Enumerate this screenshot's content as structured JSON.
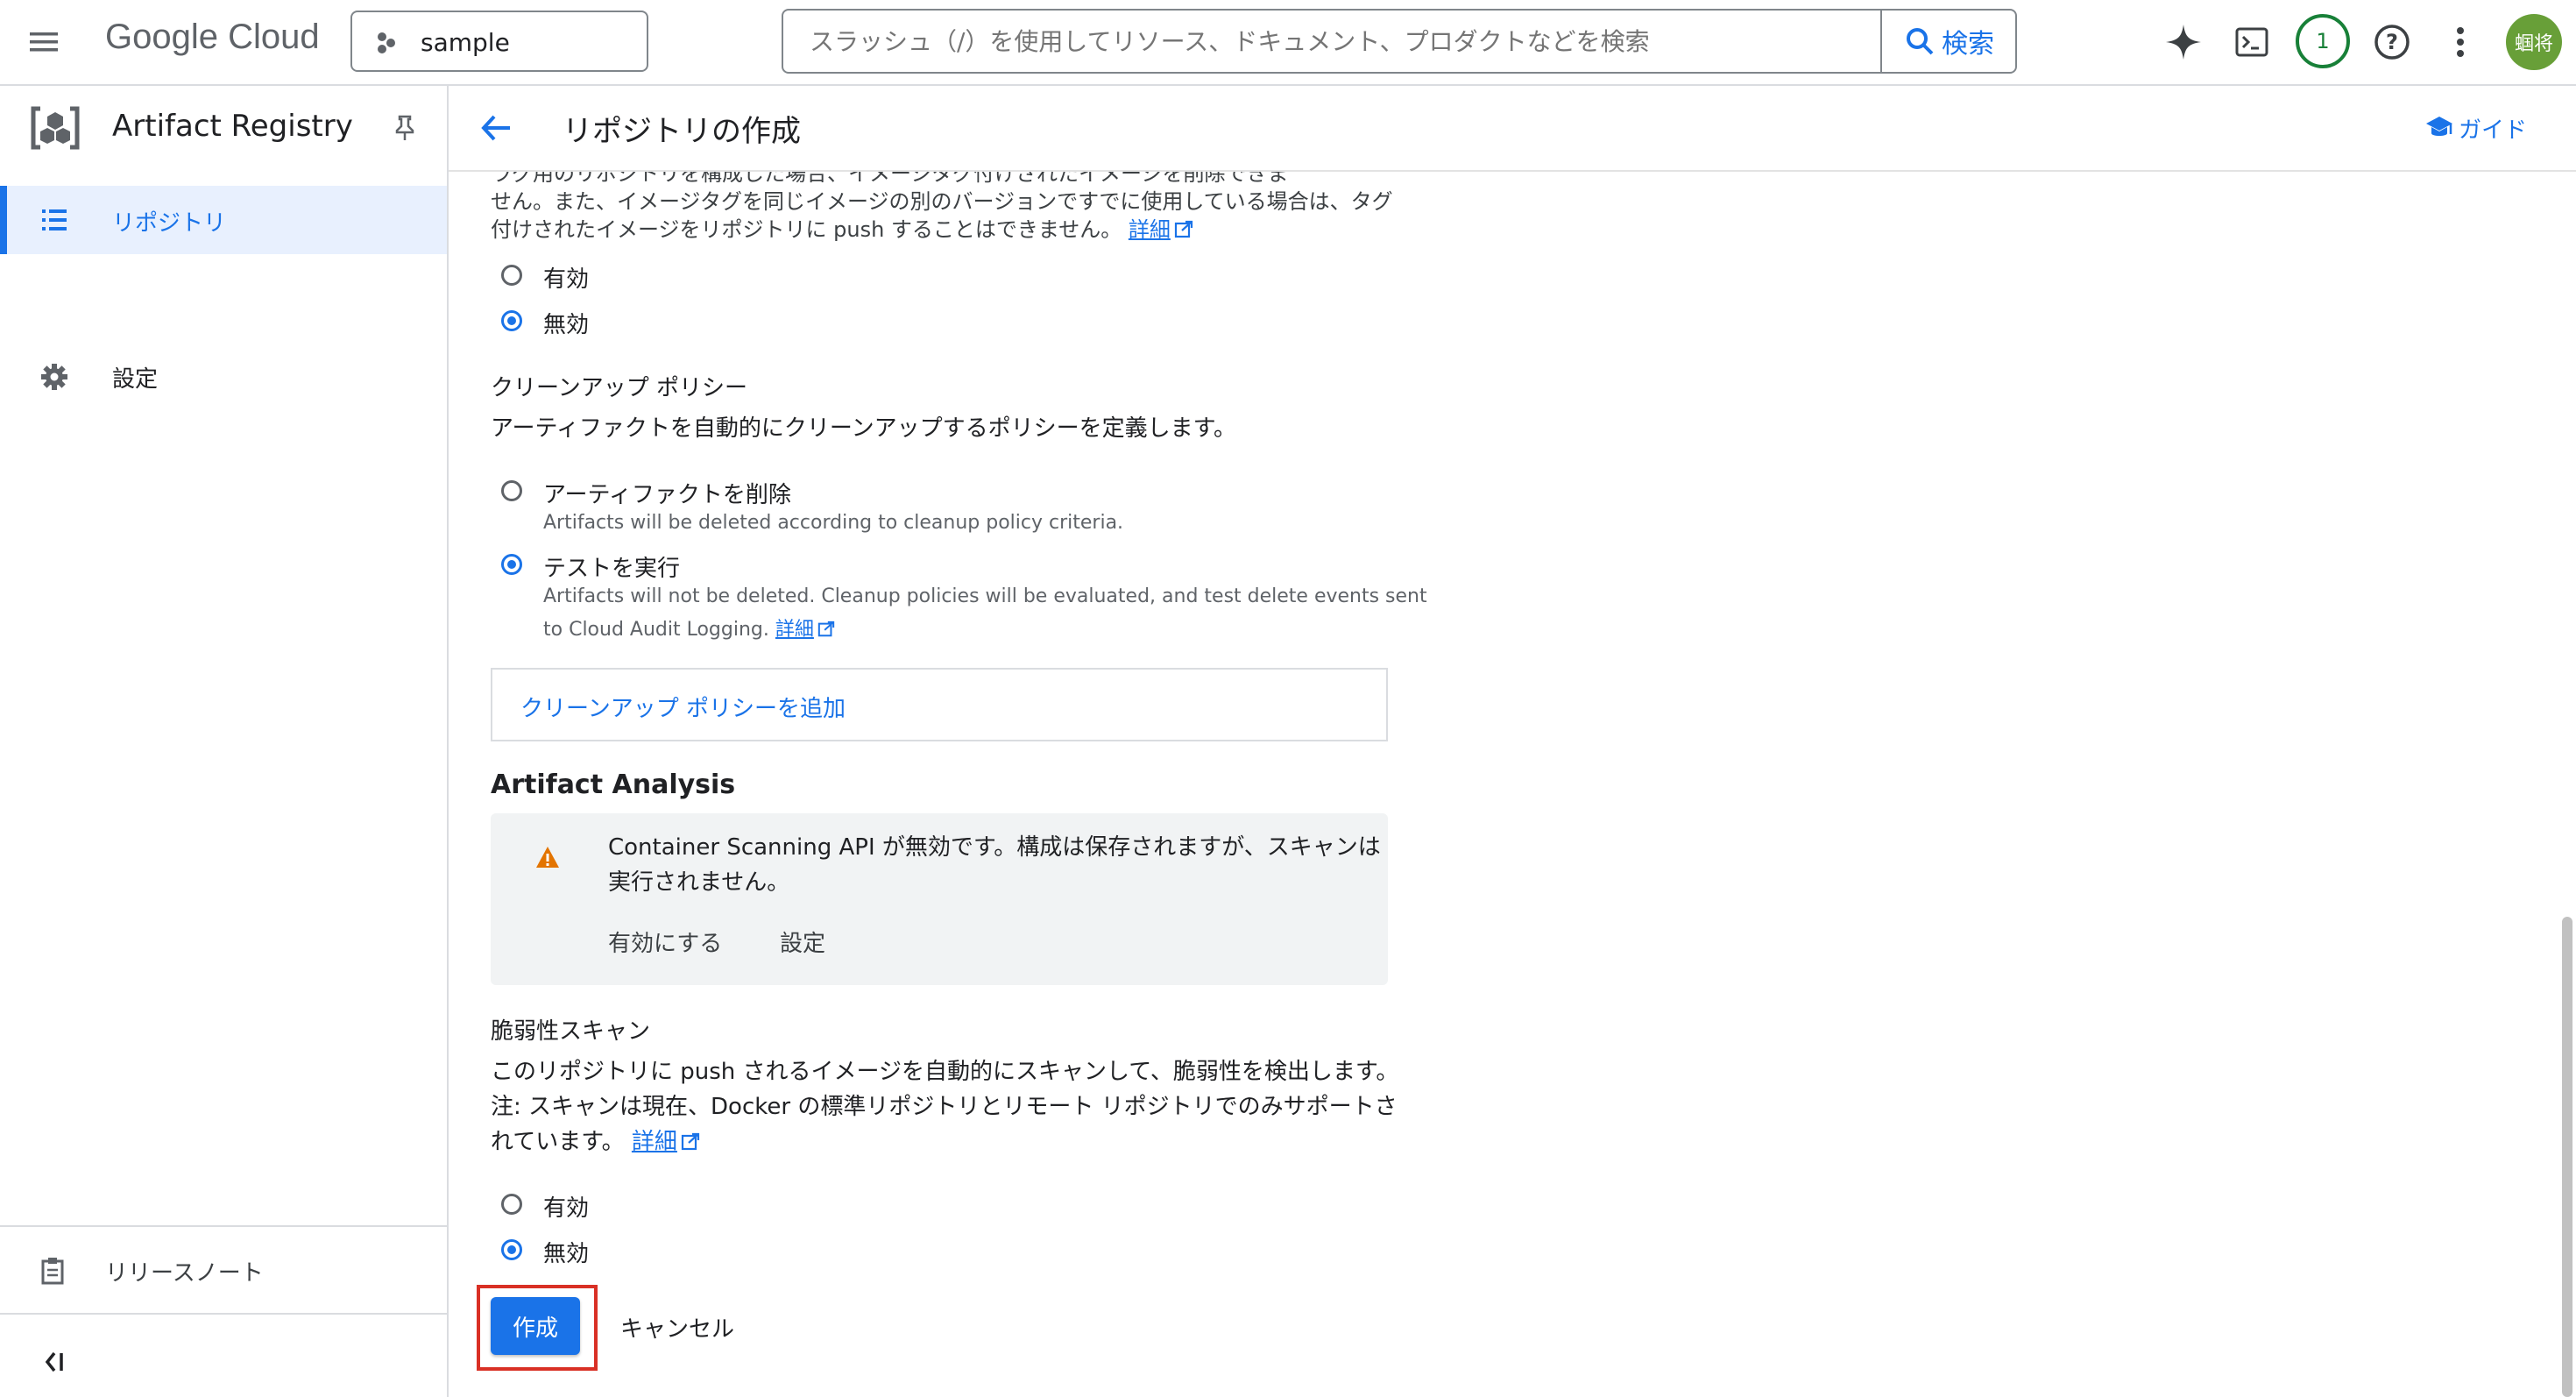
{
  "topbar": {
    "brand": "Google Cloud",
    "project": "sample",
    "search_placeholder": "スラッシュ（/）を使用してリソース、ドキュメント、プロダクトなどを検索",
    "search_button": "検索",
    "notification_count": "1",
    "avatar_text": "蝈将"
  },
  "sidebar": {
    "product": "Artifact Registry",
    "items": [
      {
        "label": "リポジトリ"
      },
      {
        "label": "設定"
      }
    ],
    "release_notes": "リリースノート",
    "collapse": "<|"
  },
  "header": {
    "title": "リポジトリの作成",
    "guide": "ガイド"
  },
  "immutable": {
    "cut_line": "ラグ用のリポジトリを構成した場合、イメージタグ付けされたイメージを削除できま",
    "line2": "せん。また、イメージタグを同じイメージの別のバージョンですでに使用している場合は、タグ",
    "line3": "付けされたイメージをリポジトリに push することはできません。",
    "learn_more": "詳細",
    "options": [
      "有効",
      "無効"
    ]
  },
  "cleanup": {
    "title": "クリーンアップ ポリシー",
    "desc": "アーティファクトを自動的にクリーンアップするポリシーを定義します。",
    "delete_label": "アーティファクトを削除",
    "delete_help": "Artifacts will be deleted according to cleanup policy criteria.",
    "dryrun_label": "テストを実行",
    "dryrun_help1": "Artifacts will not be deleted. Cleanup policies will be evaluated, and test delete events sent",
    "dryrun_help2": "to Cloud Audit Logging.",
    "learn_more": "詳細",
    "add_policy": "クリーンアップ ポリシーを追加"
  },
  "analysis": {
    "title": "Artifact Analysis",
    "warning1": "Container Scanning API が無効です。構成は保存されますが、スキャンは",
    "warning2": "実行されません。",
    "enable": "有効にする",
    "settings": "設定"
  },
  "vuln": {
    "title": "脆弱性スキャン",
    "desc1": "このリポジトリに push されるイメージを自動的にスキャンして、脆弱性を検出します。",
    "desc2": "注: スキャンは現在、Docker の標準リポジトリとリモート リポジトリでのみサポートさ",
    "desc3": "れています。",
    "learn_more": "詳細",
    "options": [
      "有効",
      "無効"
    ]
  },
  "actions": {
    "create": "作成",
    "cancel": "キャンセル"
  }
}
